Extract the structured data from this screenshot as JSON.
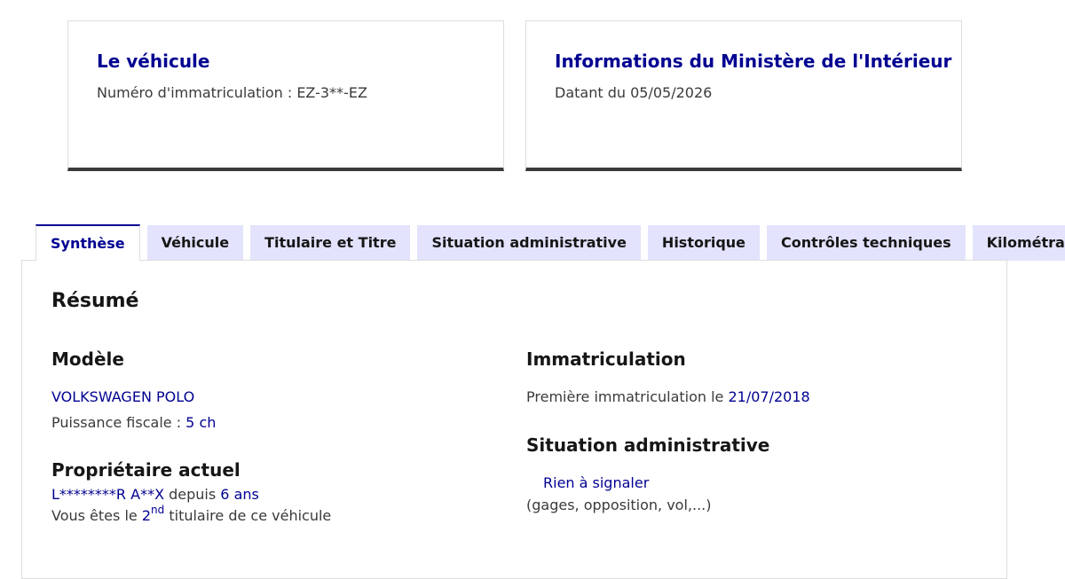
{
  "cards": {
    "vehicle": {
      "title": "Le véhicule",
      "desc": "Numéro d'immatriculation : EZ-3**-EZ"
    },
    "ministry": {
      "title": "Informations du Ministère de l'Intérieur",
      "desc": "Datant du 05/05/2026"
    }
  },
  "tabs": [
    {
      "label": "Synthèse",
      "active": true
    },
    {
      "label": "Véhicule",
      "active": false
    },
    {
      "label": "Titulaire et Titre",
      "active": false
    },
    {
      "label": "Situation administrative",
      "active": false
    },
    {
      "label": "Historique",
      "active": false
    },
    {
      "label": "Contrôles techniques",
      "active": false
    },
    {
      "label": "Kilométrage",
      "active": false
    }
  ],
  "summary": {
    "title": "Résumé",
    "model": {
      "heading": "Modèle",
      "name": "VOLKSWAGEN POLO",
      "power_label": "Puissance fiscale :",
      "power_value": "5 ch"
    },
    "owner": {
      "heading": "Propriétaire actuel",
      "name": "L********R A**X",
      "since_label": "depuis",
      "since_value": "6 ans",
      "rank_prefix": "Vous êtes le",
      "rank_number": "2",
      "rank_suffix": "nd",
      "rank_rest": "titulaire de ce véhicule"
    },
    "registration": {
      "heading": "Immatriculation",
      "first_label": "Première immatriculation le",
      "first_date": "21/07/2018"
    },
    "admin": {
      "heading": "Situation administrative",
      "status": "Rien à signaler",
      "detail": "(gages, opposition, vol,...)"
    }
  },
  "colors": {
    "primary_blue": "#000091",
    "tab_bg": "#e3e3fd",
    "text": "#3a3a3a",
    "heading": "#161616"
  }
}
